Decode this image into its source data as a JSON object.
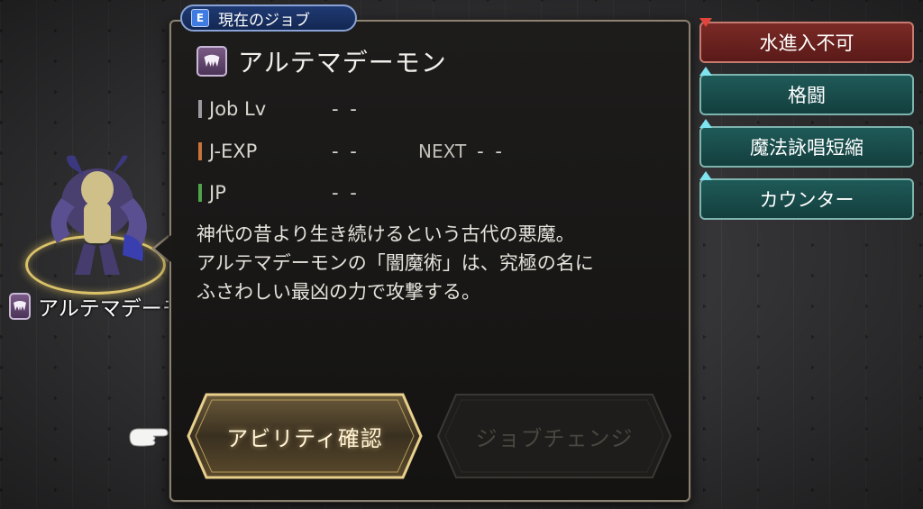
{
  "header_tab": {
    "badge": "E",
    "label": "現在のジョブ"
  },
  "job": {
    "name": "アルテマデーモン",
    "icon": "demon-fang-icon"
  },
  "stats": [
    {
      "label": "Job Lv",
      "value": "‐ ‐",
      "bar_color": "#9a9aa0"
    },
    {
      "label": "J-EXP",
      "value": "‐ ‐",
      "bar_color": "#c8733a"
    },
    {
      "label": "JP",
      "value": "‐ ‐",
      "bar_color": "#4fa34a"
    }
  ],
  "next": {
    "label": "NEXT",
    "value": "‐ ‐"
  },
  "description": [
    "神代の昔より生き続けるという古代の悪魔。",
    "アルテマデーモンの「闇魔術」は、究極の名に",
    "ふさわしい最凶の力で攻撃する。"
  ],
  "buttons": {
    "ability": "アビリティ確認",
    "job_change": "ジョブチェンジ"
  },
  "unit": {
    "name": "アルテマデーモン"
  },
  "tags": [
    {
      "label": "水進入不可",
      "type": "negative"
    },
    {
      "label": "格闘",
      "type": "positive"
    },
    {
      "label": "魔法詠唱短縮",
      "type": "positive"
    },
    {
      "label": "カウンター",
      "type": "positive"
    }
  ],
  "colors": {
    "panel_border": "#8b8170",
    "negative_tag": "#7a2a26",
    "positive_tag": "#1f5a58",
    "header_tab": "#1f3a73"
  }
}
